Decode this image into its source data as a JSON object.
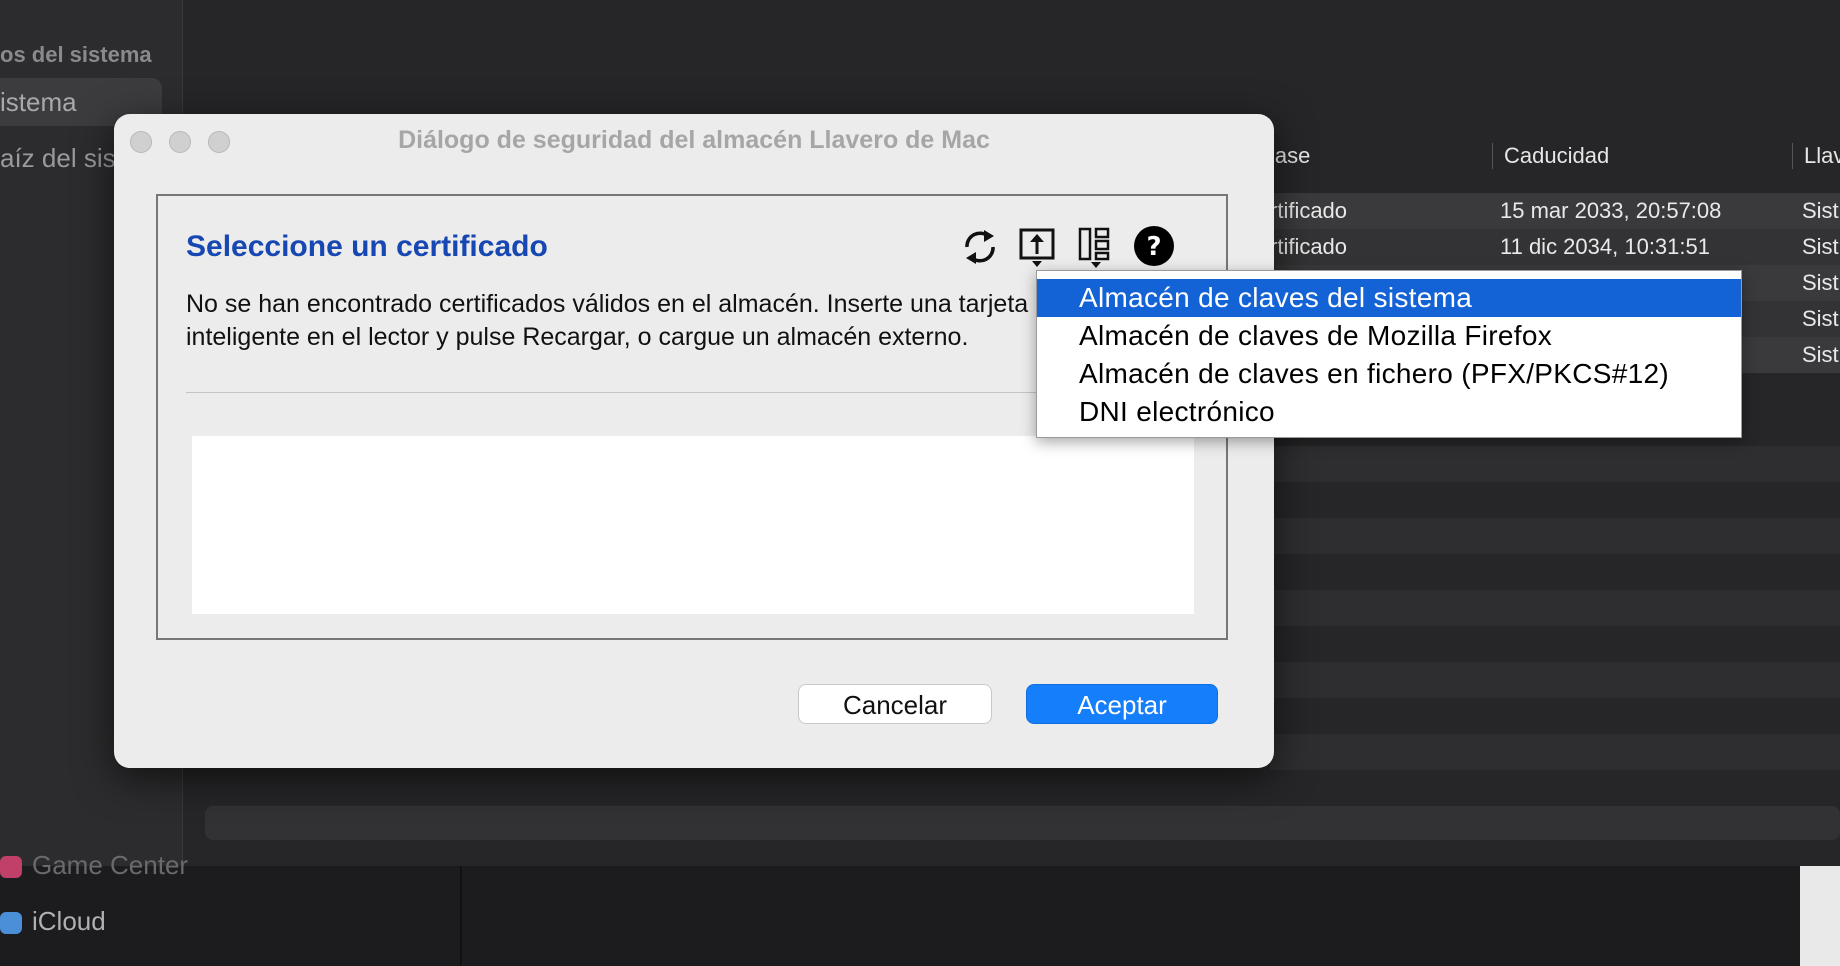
{
  "background": {
    "sidebar": {
      "header": "os del sistema",
      "items": [
        {
          "label": "istema",
          "selected": true
        },
        {
          "label": "aíz del sis",
          "selected": false
        }
      ],
      "bottom_items": [
        {
          "label": "Game Center",
          "icon": "game-center-icon"
        },
        {
          "label": "iCloud",
          "icon": "icloud-icon"
        }
      ]
    },
    "table": {
      "columns": [
        "lase",
        "Caducidad",
        "Llav"
      ],
      "rows": [
        {
          "kind": "rtificado",
          "expiry": "15 mar 2033, 20:57:08",
          "keychain": "Sist"
        },
        {
          "kind": "rtificado",
          "expiry": "11 dic 2034, 10:31:51",
          "keychain": "Sist"
        },
        {
          "kind": "",
          "expiry": "",
          "keychain": "Sist"
        },
        {
          "kind": "",
          "expiry": "",
          "keychain": "Sist"
        },
        {
          "kind": "",
          "expiry": "",
          "keychain": "Sist"
        }
      ]
    }
  },
  "dialog": {
    "title": "Diálogo de seguridad del almacén Llavero de Mac",
    "heading": "Seleccione un certificado",
    "message_line1": "No se han encontrado certificados válidos en el almacén. Inserte una tarjeta",
    "message_line2": "inteligente en el lector y pulse Recargar, o cargue un almacén externo.",
    "toolbar_icons": [
      "refresh-icon",
      "open-keystore-icon",
      "view-options-icon",
      "help-icon"
    ],
    "cancel_label": "Cancelar",
    "accept_label": "Aceptar",
    "accent_color": "#157efb",
    "heading_color": "#1747b2"
  },
  "dropdown": {
    "items": [
      {
        "label": "Almacén de claves del sistema",
        "selected": true
      },
      {
        "label": "Almacén de claves de Mozilla Firefox",
        "selected": false
      },
      {
        "label": "Almacén de claves en fichero (PFX/PKCS#12)",
        "selected": false
      },
      {
        "label": "DNI electrónico",
        "selected": false
      }
    ],
    "highlight_color": "#1463d6"
  }
}
